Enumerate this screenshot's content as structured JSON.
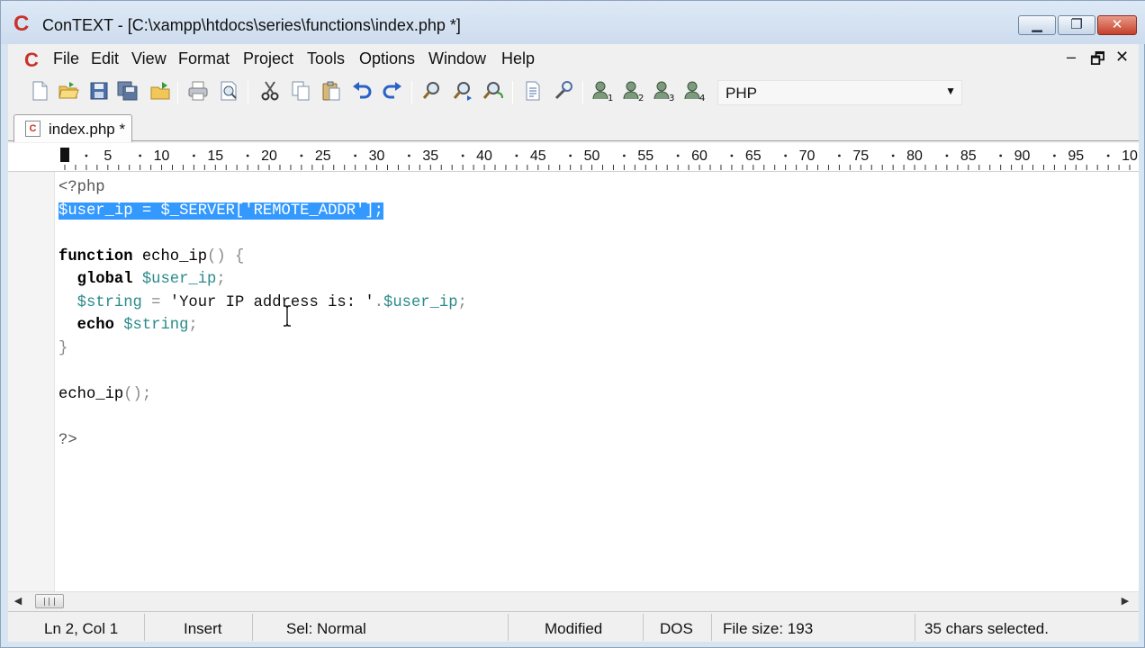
{
  "window": {
    "title": "ConTEXT - [C:\\xampp\\htdocs\\series\\functions\\index.php *]",
    "app_icon_glyph": "C",
    "minimize_glyph": "▁",
    "maximize_glyph": "❐",
    "close_glyph": "✕"
  },
  "menubar": {
    "items": [
      "File",
      "Edit",
      "View",
      "Format",
      "Project",
      "Tools",
      "Options",
      "Window",
      "Help"
    ],
    "mdi_controls": [
      "–",
      "🗗",
      "✕"
    ]
  },
  "toolbar": {
    "buttons": [
      "new-file-icon",
      "open-folder-icon",
      "save-icon",
      "save-all-icon",
      "open-project-icon",
      "print-icon",
      "print-preview-icon",
      "cut-icon",
      "copy-icon",
      "paste-icon",
      "undo-icon",
      "redo-icon",
      "find-icon",
      "find-next-icon",
      "replace-icon",
      "convert-icon",
      "tools-icon",
      "user-command-1-icon",
      "user-command-2-icon",
      "user-command-3-icon",
      "user-command-4-icon"
    ],
    "syntax_highlighter": "PHP"
  },
  "tabs": [
    {
      "label": "index.php *",
      "icon": "php-file-icon"
    }
  ],
  "ruler": {
    "labels": [
      "5",
      "10",
      "15",
      "20",
      "25",
      "30",
      "35",
      "40",
      "45",
      "50",
      "55",
      "60",
      "65",
      "70",
      "75",
      "80",
      "85",
      "90",
      "95",
      "10"
    ]
  },
  "editor": {
    "lines": [
      [
        {
          "t": "<?php",
          "c": "tag"
        }
      ],
      [
        {
          "t": "$user_ip = $_SERVER['REMOTE_ADDR'];",
          "c": "sel"
        }
      ],
      [],
      [
        {
          "t": "function",
          "c": "kw"
        },
        {
          "t": " echo_ip",
          "c": "plain"
        },
        {
          "t": "() {",
          "c": "punc"
        }
      ],
      [
        {
          "t": "  global",
          "c": "kw"
        },
        {
          "t": " $user_ip",
          "c": "var"
        },
        {
          "t": ";",
          "c": "punc"
        }
      ],
      [
        {
          "t": "  $string",
          "c": "var"
        },
        {
          "t": " = ",
          "c": "punc"
        },
        {
          "t": "'Your IP address is: '",
          "c": "str"
        },
        {
          "t": ".",
          "c": "punc"
        },
        {
          "t": "$user_ip",
          "c": "var"
        },
        {
          "t": ";",
          "c": "punc"
        }
      ],
      [
        {
          "t": "  echo",
          "c": "kw"
        },
        {
          "t": " $string",
          "c": "var"
        },
        {
          "t": ";",
          "c": "punc"
        }
      ],
      [
        {
          "t": "}",
          "c": "punc"
        }
      ],
      [],
      [
        {
          "t": "echo_ip",
          "c": "plain"
        },
        {
          "t": "();",
          "c": "punc"
        }
      ],
      [],
      [
        {
          "t": "?>",
          "c": "tag"
        }
      ]
    ]
  },
  "statusbar": {
    "position": "Ln 2, Col 1",
    "mode": "Insert",
    "selection_mode": "Sel: Normal",
    "modified": "Modified",
    "line_endings": "DOS",
    "file_size": "File size: 193",
    "selection_info": "35 chars selected."
  },
  "colors": {
    "selection": "#3399ff",
    "variable": "#2b8a8a",
    "title_bar": "#d7e4f2"
  }
}
